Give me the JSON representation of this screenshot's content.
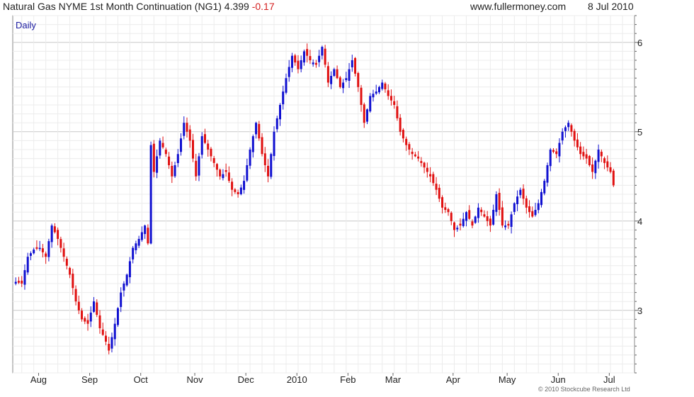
{
  "header": {
    "title": "Natural Gas NYME 1st Month Continuation (NG1) 4.399",
    "change": "-0.17",
    "website": "www.fullermoney.com",
    "date": "8 Jul 2010"
  },
  "footer": {
    "copyright": "© 2010 Stockcube Research Ltd"
  },
  "chart_data": {
    "type": "candlestick",
    "period_label": "Daily",
    "up_color": "#1010d0",
    "down_color": "#e01010",
    "grid": true,
    "y_axis_side": "right",
    "ylim": [
      2.3,
      6.3
    ],
    "yticks": [
      3,
      4,
      5,
      6
    ],
    "x_labels": [
      "Aug",
      "Sep",
      "Oct",
      "Nov",
      "Dec",
      "2010",
      "Feb",
      "Mar",
      "Apr",
      "May",
      "Jun",
      "Jul"
    ],
    "x_label_positions": [
      8.6,
      25.6,
      42.6,
      60.6,
      77.6,
      94.6,
      111.6,
      126.6,
      146.6,
      164.6,
      181.6,
      198.6
    ],
    "x_range": [
      0,
      207
    ],
    "series": [
      {
        "name": "Natural Gas NYME 1st Month Continuation (NG1)",
        "close_anchors": [
          [
            0,
            3.32
          ],
          [
            2,
            3.3
          ],
          [
            4,
            3.6
          ],
          [
            6,
            3.68
          ],
          [
            8,
            3.7
          ],
          [
            10,
            3.6
          ],
          [
            12,
            3.95
          ],
          [
            14,
            3.8
          ],
          [
            16,
            3.6
          ],
          [
            18,
            3.4
          ],
          [
            20,
            3.1
          ],
          [
            22,
            2.9
          ],
          [
            24,
            2.85
          ],
          [
            26,
            3.1
          ],
          [
            28,
            2.8
          ],
          [
            30,
            2.65
          ],
          [
            31,
            2.55
          ],
          [
            33,
            2.85
          ],
          [
            35,
            3.2
          ],
          [
            37,
            3.4
          ],
          [
            39,
            3.7
          ],
          [
            41,
            3.8
          ],
          [
            43,
            3.95
          ],
          [
            44,
            3.75
          ],
          [
            45,
            4.85
          ],
          [
            46,
            4.55
          ],
          [
            48,
            4.9
          ],
          [
            50,
            4.75
          ],
          [
            52,
            4.5
          ],
          [
            54,
            4.75
          ],
          [
            56,
            5.1
          ],
          [
            58,
            4.9
          ],
          [
            60,
            4.5
          ],
          [
            62,
            4.95
          ],
          [
            64,
            4.8
          ],
          [
            66,
            4.65
          ],
          [
            68,
            4.5
          ],
          [
            70,
            4.55
          ],
          [
            72,
            4.35
          ],
          [
            74,
            4.3
          ],
          [
            76,
            4.45
          ],
          [
            78,
            4.8
          ],
          [
            80,
            5.1
          ],
          [
            82,
            4.75
          ],
          [
            84,
            4.5
          ],
          [
            86,
            5.0
          ],
          [
            88,
            5.3
          ],
          [
            90,
            5.6
          ],
          [
            92,
            5.85
          ],
          [
            94,
            5.7
          ],
          [
            96,
            5.9
          ],
          [
            98,
            5.8
          ],
          [
            100,
            5.75
          ],
          [
            102,
            5.95
          ],
          [
            104,
            5.55
          ],
          [
            106,
            5.7
          ],
          [
            108,
            5.5
          ],
          [
            110,
            5.6
          ],
          [
            112,
            5.8
          ],
          [
            114,
            5.5
          ],
          [
            116,
            5.1
          ],
          [
            118,
            5.4
          ],
          [
            120,
            5.45
          ],
          [
            122,
            5.55
          ],
          [
            124,
            5.4
          ],
          [
            126,
            5.3
          ],
          [
            128,
            5.0
          ],
          [
            130,
            4.85
          ],
          [
            132,
            4.75
          ],
          [
            134,
            4.7
          ],
          [
            136,
            4.6
          ],
          [
            138,
            4.5
          ],
          [
            140,
            4.35
          ],
          [
            142,
            4.15
          ],
          [
            144,
            4.1
          ],
          [
            146,
            3.9
          ],
          [
            148,
            3.95
          ],
          [
            150,
            4.1
          ],
          [
            152,
            3.95
          ],
          [
            154,
            4.15
          ],
          [
            156,
            4.05
          ],
          [
            158,
            3.95
          ],
          [
            160,
            4.3
          ],
          [
            162,
            3.95
          ],
          [
            164,
            3.95
          ],
          [
            166,
            4.2
          ],
          [
            168,
            4.35
          ],
          [
            170,
            4.15
          ],
          [
            172,
            4.05
          ],
          [
            174,
            4.2
          ],
          [
            176,
            4.45
          ],
          [
            178,
            4.8
          ],
          [
            180,
            4.75
          ],
          [
            182,
            5.0
          ],
          [
            184,
            5.1
          ],
          [
            186,
            4.9
          ],
          [
            188,
            4.75
          ],
          [
            190,
            4.7
          ],
          [
            192,
            4.55
          ],
          [
            194,
            4.8
          ],
          [
            196,
            4.65
          ],
          [
            198,
            4.55
          ],
          [
            199,
            4.4
          ]
        ]
      }
    ]
  }
}
